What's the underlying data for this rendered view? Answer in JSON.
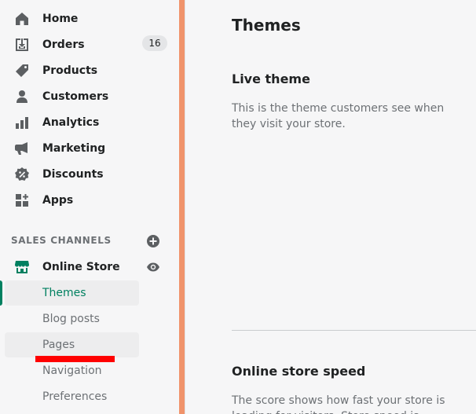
{
  "nav": {
    "items": [
      {
        "label": "Home",
        "icon": "home-icon"
      },
      {
        "label": "Orders",
        "icon": "orders-icon",
        "badge": "16"
      },
      {
        "label": "Products",
        "icon": "tag-icon"
      },
      {
        "label": "Customers",
        "icon": "person-icon"
      },
      {
        "label": "Analytics",
        "icon": "bar-chart-icon"
      },
      {
        "label": "Marketing",
        "icon": "megaphone-icon"
      },
      {
        "label": "Discounts",
        "icon": "discount-icon"
      },
      {
        "label": "Apps",
        "icon": "apps-icon"
      }
    ]
  },
  "sales_channels": {
    "header": "SALES CHANNELS",
    "online_store": {
      "label": "Online Store",
      "subitems": [
        "Themes",
        "Blog posts",
        "Pages",
        "Navigation",
        "Preferences"
      ],
      "active": "Themes"
    }
  },
  "main": {
    "title": "Themes",
    "live_theme": {
      "title": "Live theme",
      "description": "This is the theme customers see when they visit your store."
    },
    "speed": {
      "title": "Online store speed",
      "description": "The score shows how fast your store is loading for visitors. Store speed is"
    }
  },
  "colors": {
    "accent": "#008060",
    "highlight": "#ff0000",
    "divider": "#f0936b"
  }
}
